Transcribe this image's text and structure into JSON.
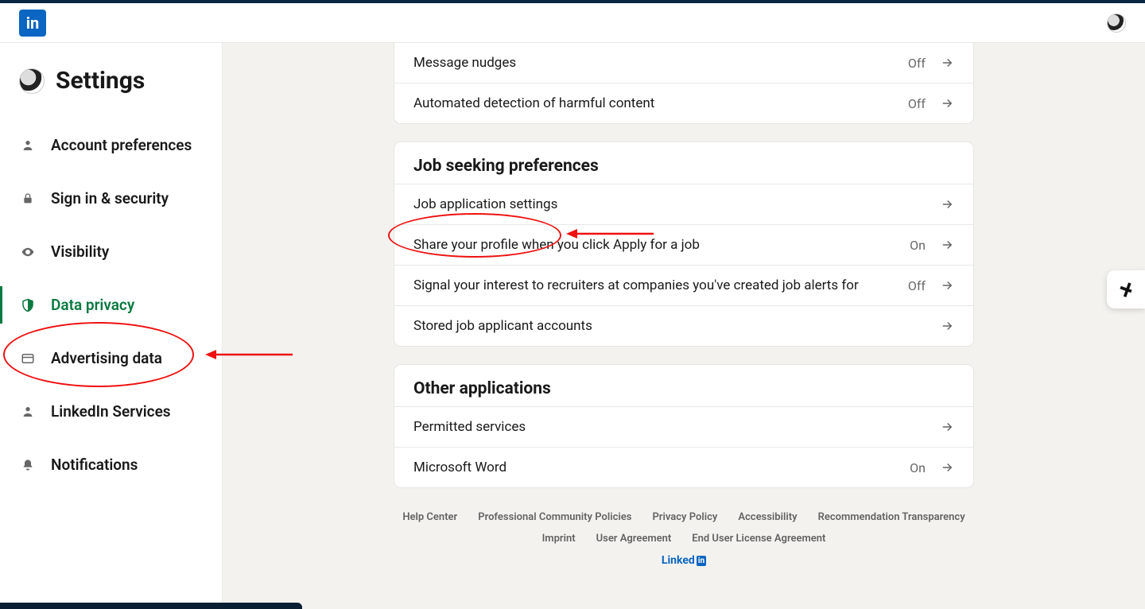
{
  "nav": {
    "logo_text": "in"
  },
  "sidebar": {
    "title": "Settings",
    "items": [
      {
        "label": "Account preferences",
        "icon": "user"
      },
      {
        "label": "Sign in & security",
        "icon": "lock"
      },
      {
        "label": "Visibility",
        "icon": "eye"
      },
      {
        "label": "Data privacy",
        "icon": "shield",
        "active": true
      },
      {
        "label": "Advertising data",
        "icon": "adv"
      },
      {
        "label": "LinkedIn Services",
        "icon": "user"
      },
      {
        "label": "Notifications",
        "icon": "bell"
      }
    ]
  },
  "sections": {
    "top_rows": [
      {
        "label": "Message nudges",
        "status": "Off"
      },
      {
        "label": "Automated detection of harmful content",
        "status": "Off"
      }
    ],
    "job": {
      "heading": "Job seeking preferences",
      "rows": [
        {
          "label": "Job application settings",
          "status": ""
        },
        {
          "label": "Share your profile when you click Apply for a job",
          "status": "On"
        },
        {
          "label": "Signal your interest to recruiters at companies you've created job alerts for",
          "status": "Off"
        },
        {
          "label": "Stored job applicant accounts",
          "status": ""
        }
      ]
    },
    "other": {
      "heading": "Other applications",
      "rows": [
        {
          "label": "Permitted services",
          "status": ""
        },
        {
          "label": "Microsoft Word",
          "status": "On"
        }
      ]
    }
  },
  "footer": {
    "row1": [
      "Help Center",
      "Professional Community Policies",
      "Privacy Policy",
      "Accessibility",
      "Recommendation Transparency"
    ],
    "row2": [
      "Imprint",
      "User Agreement",
      "End User License Agreement"
    ],
    "brand_word": "Linked",
    "brand_box": "in"
  }
}
